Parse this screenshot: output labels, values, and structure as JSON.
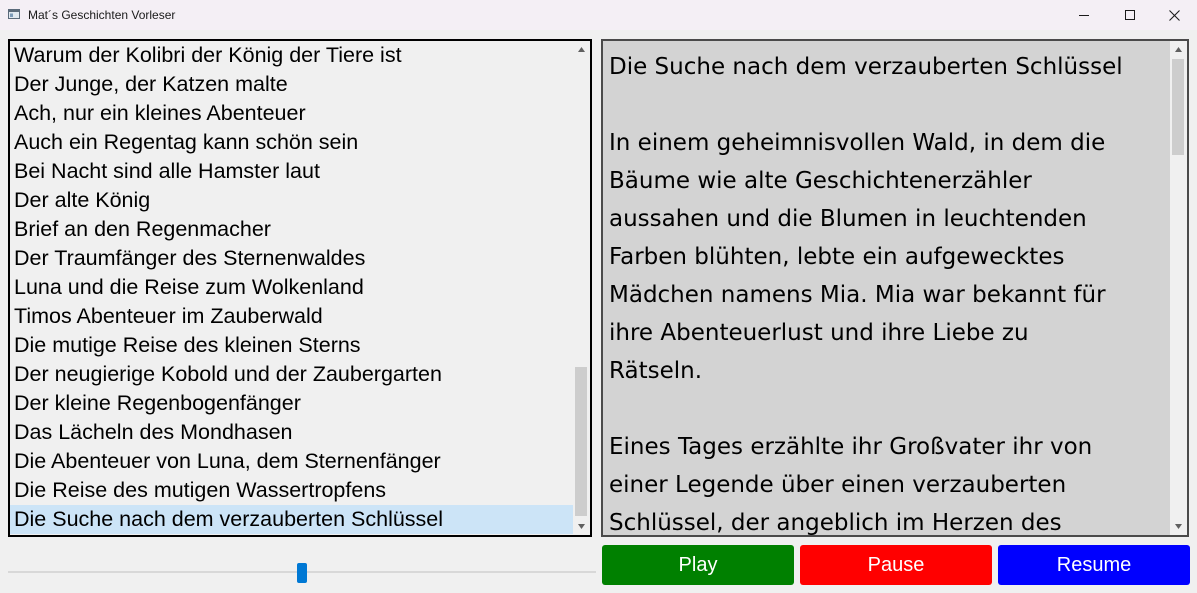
{
  "window": {
    "title": "Mat´s Geschichten Vorleser"
  },
  "story_list": {
    "items": [
      "Warum der Kolibri der König der Tiere ist",
      "Der Junge, der Katzen malte",
      "Ach, nur ein kleines Abenteuer",
      "Auch ein Regentag kann schön sein",
      "Bei Nacht sind alle Hamster laut",
      "Der alte König",
      "Brief an den Regenmacher",
      "Der Traumfänger des Sternenwaldes",
      "Luna und die Reise zum Wolkenland",
      "Timos Abenteuer im Zauberwald",
      "Die mutige Reise des kleinen Sterns",
      "Der neugierige Kobold und der Zaubergarten",
      "Der kleine Regenbogenfänger",
      "Das Lächeln des Mondhasen",
      "Die Abenteuer von Luna, dem Sternenfänger",
      "Die Reise des mutigen Wassertropfens",
      "Die Suche nach dem verzauberten Schlüssel"
    ],
    "selected_index": 16,
    "selection_color": "#cce4f7"
  },
  "story_text": {
    "lines": [
      "Die Suche nach dem verzauberten Schlüssel",
      "",
      "In einem geheimnisvollen Wald, in dem die",
      "Bäume wie alte Geschichtenerzähler",
      "aussahen und die Blumen in leuchtenden",
      "Farben blühten, lebte ein aufgewecktes",
      "Mädchen namens Mia. Mia war bekannt für",
      "ihre Abenteuerlust und ihre Liebe zu",
      "Rätseln.",
      "",
      "Eines Tages erzählte ihr Großvater ihr von",
      "einer Legende über einen verzauberten",
      "Schlüssel, der angeblich im Herzen des"
    ]
  },
  "slider": {
    "value_fraction": 0.5
  },
  "controls": {
    "play_label": "Play",
    "pause_label": "Pause",
    "resume_label": "Resume",
    "play_color": "#008000",
    "pause_color": "#ff0000",
    "resume_color": "#0000ff"
  },
  "icons": {
    "app": "window-app-icon",
    "minimize": "minimize-icon",
    "maximize": "maximize-icon",
    "close": "close-icon"
  }
}
